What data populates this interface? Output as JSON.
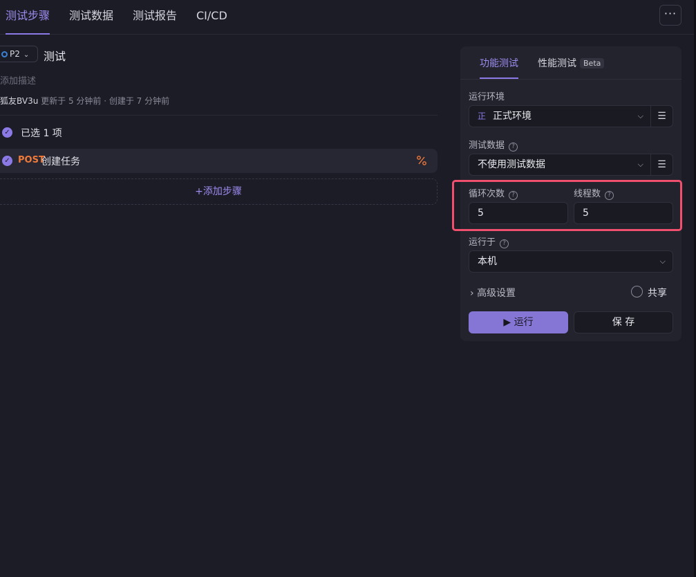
{
  "tabs": [
    {
      "label": "测试步骤"
    },
    {
      "label": "测试数据"
    },
    {
      "label": "测试报告"
    },
    {
      "label": "CI/CD"
    }
  ],
  "more_label": "···",
  "case": {
    "priority": "P2",
    "title": "测试",
    "description_placeholder": "添加描述",
    "author": "狐友BV3u",
    "meta_text": "更新于 5 分钟前 · 创建于 7 分钟前"
  },
  "steps": {
    "selected_label": "已选 1 项",
    "items": [
      {
        "method": "POST",
        "name": "创建任务"
      }
    ],
    "add_label": "添加步骤"
  },
  "panel": {
    "tab_functional": "功能测试",
    "tab_performance": "性能测试",
    "beta_badge": "Beta",
    "env_label": "运行环境",
    "env_badge": "正",
    "env_value": "正式环境",
    "testdata_label": "测试数据",
    "testdata_value": "不使用测试数据",
    "loop_label": "循环次数",
    "loop_value": "5",
    "thread_label": "线程数",
    "thread_value": "5",
    "runon_label": "运行于",
    "runon_value": "本机",
    "advanced_label": "高级设置",
    "share_label": "共享",
    "run_label": "运行",
    "save_label": "保 存"
  },
  "colors": {
    "accent": "#8b7ae6",
    "method_post": "#f07a3a",
    "highlight": "#f0506e"
  }
}
